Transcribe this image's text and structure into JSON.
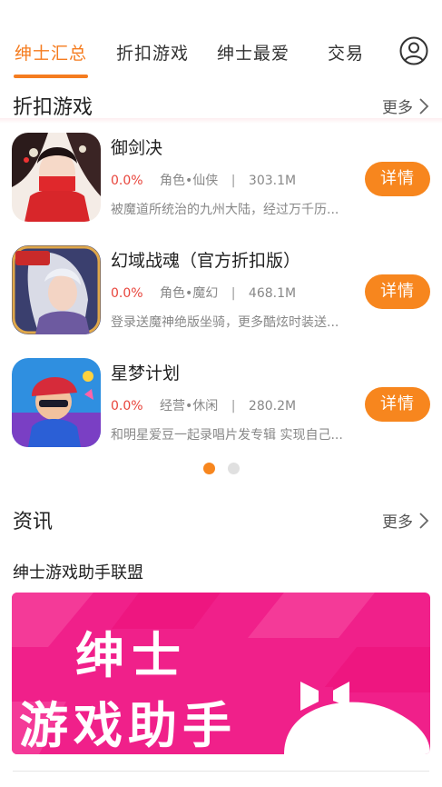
{
  "tabs": [
    {
      "label": "绅士汇总",
      "active": true
    },
    {
      "label": "折扣游戏",
      "active": false
    },
    {
      "label": "绅士最爱",
      "active": false
    },
    {
      "label": "交易",
      "active": false
    }
  ],
  "user_icon": "user-icon",
  "discount_section": {
    "title": "折扣游戏",
    "more_label": "更多",
    "games": [
      {
        "name": "御剑决",
        "discount": "0.0%",
        "category": "角色•仙侠",
        "size": "303.1M",
        "desc": "被魔道所统治的九州大陆，经过万千历...",
        "button": "详情"
      },
      {
        "name": "幻域战魂（官方折扣版）",
        "discount": "0.0%",
        "category": "角色•魔幻",
        "size": "468.1M",
        "desc": "登录送魔神绝版坐骑，更多酷炫时装送...",
        "button": "详情"
      },
      {
        "name": "星梦计划",
        "discount": "0.0%",
        "category": "经营•休闲",
        "size": "280.2M",
        "desc": "和明星爱豆一起录唱片发专辑 实现自己...",
        "button": "详情"
      }
    ],
    "pager": {
      "pages": 2,
      "current": 1
    }
  },
  "news_section": {
    "title": "资讯",
    "more_label": "更多",
    "article_title": "绅士游戏助手联盟",
    "banner_line1": "绅士",
    "banner_line2": "游戏助手"
  },
  "colors": {
    "accent": "#f57c1f",
    "button": "#f7861e",
    "discount": "#e8453c",
    "banner": "#f0208a"
  },
  "separator": "|"
}
